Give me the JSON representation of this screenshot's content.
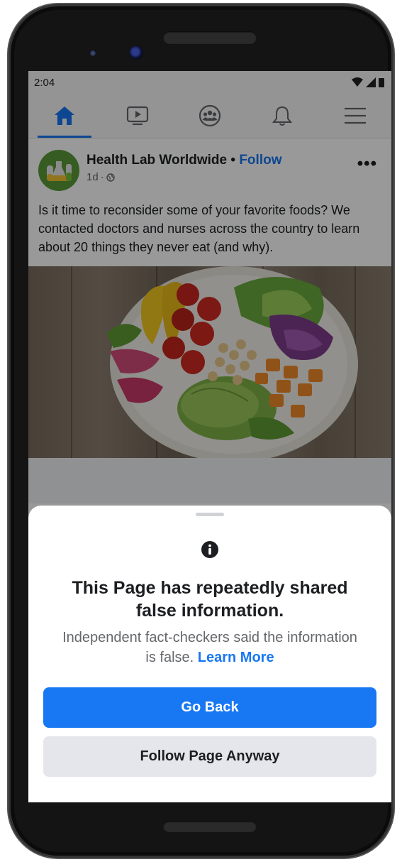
{
  "status_bar": {
    "time": "2:04"
  },
  "nav": {
    "items": [
      {
        "icon": "home-icon",
        "active": true
      },
      {
        "icon": "video-icon",
        "active": false
      },
      {
        "icon": "groups-icon",
        "active": false
      },
      {
        "icon": "bell-icon",
        "active": false
      },
      {
        "icon": "menu-icon",
        "active": false
      }
    ],
    "accent_color": "#1877f2"
  },
  "post": {
    "page_name": "Health Lab Worldwide",
    "separator": "•",
    "follow_label": "Follow",
    "time": "1d",
    "time_separator": "·",
    "privacy_icon": "globe-icon",
    "more_label": "•••",
    "text": "Is it time to reconsider some of your favorite foods? We contacted doctors and nurses across the country to learn about 20 things they never eat (and why)."
  },
  "sheet": {
    "icon": "info-icon",
    "title": "This Page has repeatedly shared false information.",
    "body": "Independent fact-checkers said the information is false.",
    "learn_more_label": "Learn More",
    "primary_button_label": "Go Back",
    "secondary_button_label": "Follow Page Anyway"
  },
  "colors": {
    "primary": "#1877f2",
    "secondary_button_bg": "#e4e6eb",
    "text_dark": "#1c1e21",
    "text_muted": "#65676b"
  }
}
